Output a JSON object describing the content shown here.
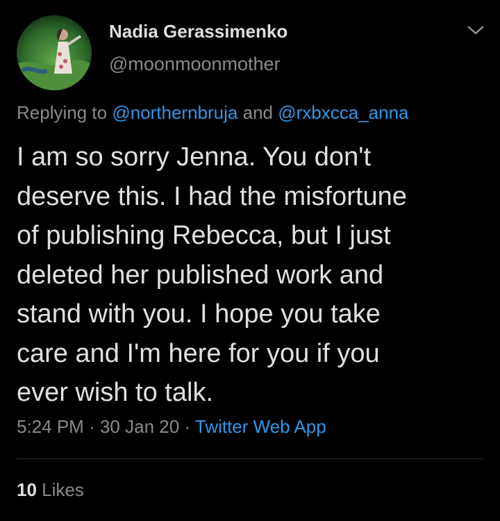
{
  "tweet": {
    "author": {
      "display_name": "Nadia Gerassimenko",
      "handle": "@moonmoonmother",
      "avatar": "avatar-photo"
    },
    "menu_icon": "chevron-down-icon",
    "reply": {
      "prefix": "Replying to",
      "mention_1": "@northernbruja",
      "conjunction": "and",
      "mention_2": "@rxbxcca_anna"
    },
    "text_lines": [
      "I am so sorry Jenna. You don't",
      "deserve this. I had the misfortune",
      "of publishing Rebecca, but I just",
      "deleted her published work and",
      "stand with you. I hope you take",
      "care and I'm here for you if you",
      "ever wish to talk."
    ],
    "meta": {
      "time": "5:24 PM",
      "separator": "·",
      "date": "30 Jan 20",
      "source": "Twitter Web App"
    },
    "likes": {
      "count": "10",
      "label": "Likes"
    },
    "colors": {
      "background": "#000000",
      "link": "#2f97e6",
      "muted": "#8a8a8a",
      "text": "#e0e0e0"
    }
  }
}
